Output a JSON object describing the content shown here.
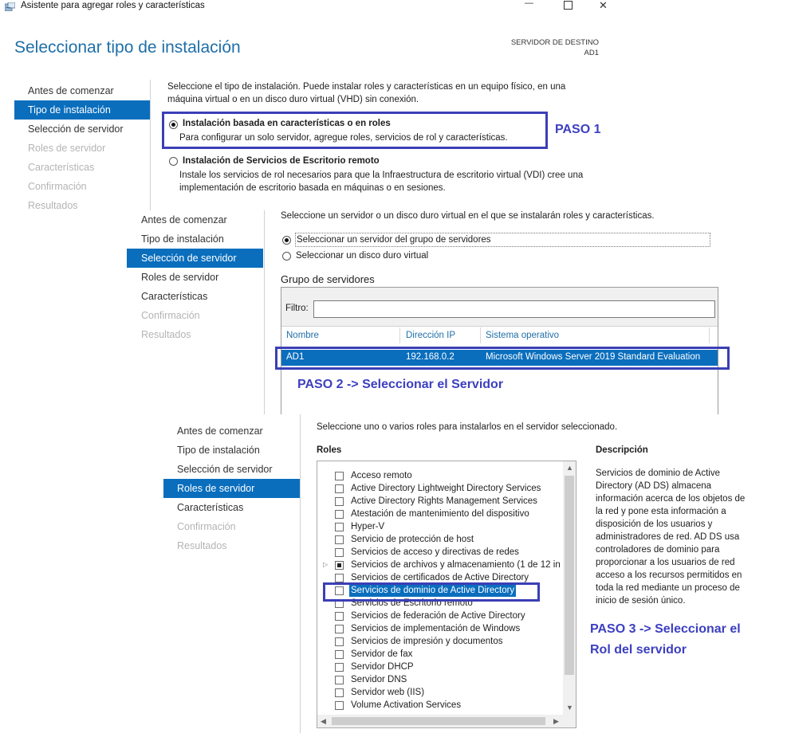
{
  "window": {
    "title": "Asistente para agregar roles y características",
    "minimize_glyph": "—",
    "maximize_glyph": "☐",
    "close_glyph": "✕"
  },
  "step1": {
    "heading": "Seleccionar tipo de instalación",
    "dest_label": "SERVIDOR DE DESTINO",
    "dest_value": "AD1",
    "nav": [
      "Antes de comenzar",
      "Tipo de instalación",
      "Selección de servidor",
      "Roles de servidor",
      "Características",
      "Confirmación",
      "Resultados"
    ],
    "intro_line1": "Seleccione el tipo de instalación. Puede instalar roles y características en un equipo físico, en una",
    "intro_line2": "máquina virtual o en un disco duro virtual (VHD) sin conexión.",
    "option1_title": "Instalación basada en características o en roles",
    "option1_desc": "Para configurar un solo servidor, agregue roles, servicios de rol y características.",
    "option2_title": "Instalación de Servicios de Escritorio remoto",
    "option2_desc_line1": "Instale los servicios de rol necesarios para que la Infraestructura de escritorio virtual (VDI) cree una",
    "option2_desc_line2": "implementación de escritorio basada en máquinas o en sesiones.",
    "annotation": "PASO 1"
  },
  "step2": {
    "nav": [
      "Antes de comenzar",
      "Tipo de instalación",
      "Selección de servidor",
      "Roles de servidor",
      "Características",
      "Confirmación",
      "Resultados"
    ],
    "intro": "Seleccione un servidor o un disco duro virtual en el que se instalarán roles y características.",
    "option1": "Seleccionar un servidor del grupo de servidores",
    "option2": "Seleccionar un disco duro virtual",
    "group_label": "Grupo de servidores",
    "filter_label": "Filtro:",
    "filter_value": "",
    "columns": [
      "Nombre",
      "Dirección IP",
      "Sistema operativo"
    ],
    "row": {
      "name": "AD1",
      "ip": "192.168.0.2",
      "os": "Microsoft Windows Server 2019 Standard Evaluation"
    },
    "annotation": "PASO 2 -> Seleccionar el Servidor"
  },
  "step3": {
    "nav": [
      "Antes de comenzar",
      "Tipo de instalación",
      "Selección de servidor",
      "Roles de servidor",
      "Características",
      "Confirmación",
      "Resultados"
    ],
    "intro": "Seleccione uno o varios roles para instalarlos en el servidor seleccionado.",
    "roles_label": "Roles",
    "desc_label": "Descripción",
    "roles": [
      "Acceso remoto",
      "Active Directory Lightweight Directory Services",
      "Active Directory Rights Management Services",
      "Atestación de mantenimiento del dispositivo",
      "Hyper-V",
      "Servicio de protección de host",
      "Servicios de acceso y directivas de redes",
      "Servicios de archivos y almacenamiento (1 de 12 in",
      "Servicios de certificados de Active Directory",
      "Servicios de dominio de Active Directory",
      "Servicios de Escritorio remoto",
      "Servicios de federación de Active Directory",
      "Servicios de implementación de Windows",
      "Servicios de impresión y documentos",
      "Servidor de fax",
      "Servidor DHCP",
      "Servidor DNS",
      "Servidor web (IIS)",
      "Volume Activation Services"
    ],
    "description": [
      "Servicios de dominio de Active",
      "Directory (AD DS) almacena",
      "información acerca de los objetos de",
      "la red y pone esta información a",
      "disposición de los usuarios y",
      "administradores de red. AD DS usa",
      "controladores de dominio para",
      "proporcionar a los usuarios de red",
      "acceso a los recursos permitidos en",
      "toda la red mediante un proceso de",
      "inicio de sesión único."
    ],
    "annotation_line1": "PASO 3 -> Seleccionar el",
    "annotation_line2": "Rol del servidor"
  },
  "colors": {
    "accent": "#0a6ebd",
    "annotation": "#3c3fc0"
  }
}
